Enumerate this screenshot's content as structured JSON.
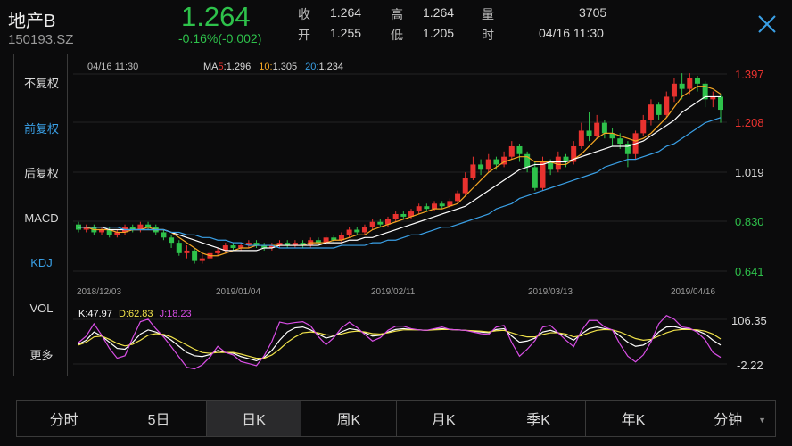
{
  "header": {
    "name": "地产B",
    "code": "150193.SZ",
    "price": "1.264",
    "change": "-0.16%(-0.002)",
    "stats": [
      {
        "label": "收",
        "value": "1.264"
      },
      {
        "label": "高",
        "value": "1.264"
      },
      {
        "label": "量",
        "value": "3705"
      },
      {
        "label": "开",
        "value": "1.255"
      },
      {
        "label": "低",
        "value": "1.205"
      },
      {
        "label": "时",
        "value": "04/16 11:30"
      }
    ]
  },
  "menu": {
    "items": [
      "不复权",
      "前复权",
      "后复权",
      "MACD",
      "KDJ",
      "VOL",
      "更多"
    ],
    "active": [
      "前复权",
      "KDJ"
    ]
  },
  "main_chart": {
    "timestamp": "04/16 11:30",
    "ma5_label": "MA5:",
    "ma5_value": "1.296",
    "ma10_label": "10:",
    "ma10_value": "1.305",
    "ma20_label": "20:",
    "ma20_value": "1.234",
    "y_ticks": [
      "1.397",
      "1.208",
      "1.019",
      "0.830",
      "0.641"
    ],
    "x_labels": [
      "2018/12/03",
      "2019/01/04",
      "2019/02/11",
      "2019/03/13",
      "2019/04/16"
    ]
  },
  "kdj_chart": {
    "k_label": "K:47.97",
    "d_label": "D:62.83",
    "j_label": "J:18.23",
    "y_ticks": [
      "106.35",
      "-2.22"
    ]
  },
  "tabs": {
    "items": [
      "分时",
      "5日",
      "日K",
      "周K",
      "月K",
      "季K",
      "年K",
      "分钟"
    ],
    "active": "日K"
  },
  "colors": {
    "up": "#e8322f",
    "down": "#2ec24b",
    "ma5": "#ffffff",
    "ma10": "#f5a623",
    "ma20": "#3aa0e6",
    "k": "#ffffff",
    "d": "#f0e24a",
    "j": "#d94ee6"
  },
  "chart_data": [
    {
      "type": "candlestick",
      "y_axis": [
        "1.397",
        "1.208",
        "1.019",
        "0.830",
        "0.641"
      ],
      "x_labels": [
        "2018/12/03",
        "2019/01/04",
        "2019/02/11",
        "2019/03/13",
        "2019/04/16"
      ],
      "candles": [
        {
          "open": 0.82,
          "close": 0.8,
          "high": 0.83,
          "low": 0.79
        },
        {
          "open": 0.8,
          "close": 0.81,
          "high": 0.82,
          "low": 0.79
        },
        {
          "open": 0.81,
          "close": 0.79,
          "high": 0.82,
          "low": 0.78
        },
        {
          "open": 0.79,
          "close": 0.8,
          "high": 0.81,
          "low": 0.78
        },
        {
          "open": 0.8,
          "close": 0.78,
          "high": 0.81,
          "low": 0.77
        },
        {
          "open": 0.78,
          "close": 0.79,
          "high": 0.8,
          "low": 0.77
        },
        {
          "open": 0.79,
          "close": 0.81,
          "high": 0.82,
          "low": 0.78
        },
        {
          "open": 0.81,
          "close": 0.8,
          "high": 0.82,
          "low": 0.79
        },
        {
          "open": 0.8,
          "close": 0.82,
          "high": 0.83,
          "low": 0.79
        },
        {
          "open": 0.82,
          "close": 0.81,
          "high": 0.83,
          "low": 0.8
        },
        {
          "open": 0.81,
          "close": 0.79,
          "high": 0.82,
          "low": 0.78
        },
        {
          "open": 0.79,
          "close": 0.77,
          "high": 0.8,
          "low": 0.76
        },
        {
          "open": 0.77,
          "close": 0.75,
          "high": 0.78,
          "low": 0.73
        },
        {
          "open": 0.75,
          "close": 0.71,
          "high": 0.76,
          "low": 0.7
        },
        {
          "open": 0.71,
          "close": 0.72,
          "high": 0.74,
          "low": 0.69
        },
        {
          "open": 0.72,
          "close": 0.68,
          "high": 0.73,
          "low": 0.67
        },
        {
          "open": 0.68,
          "close": 0.69,
          "high": 0.71,
          "low": 0.67
        },
        {
          "open": 0.69,
          "close": 0.71,
          "high": 0.72,
          "low": 0.68
        },
        {
          "open": 0.71,
          "close": 0.72,
          "high": 0.73,
          "low": 0.7
        },
        {
          "open": 0.72,
          "close": 0.74,
          "high": 0.75,
          "low": 0.71
        },
        {
          "open": 0.74,
          "close": 0.73,
          "high": 0.75,
          "low": 0.72
        },
        {
          "open": 0.73,
          "close": 0.74,
          "high": 0.75,
          "low": 0.72
        },
        {
          "open": 0.74,
          "close": 0.75,
          "high": 0.76,
          "low": 0.73
        },
        {
          "open": 0.75,
          "close": 0.74,
          "high": 0.76,
          "low": 0.73
        },
        {
          "open": 0.74,
          "close": 0.73,
          "high": 0.75,
          "low": 0.72
        },
        {
          "open": 0.73,
          "close": 0.74,
          "high": 0.75,
          "low": 0.72
        },
        {
          "open": 0.74,
          "close": 0.75,
          "high": 0.76,
          "low": 0.73
        },
        {
          "open": 0.75,
          "close": 0.74,
          "high": 0.76,
          "low": 0.73
        },
        {
          "open": 0.74,
          "close": 0.75,
          "high": 0.76,
          "low": 0.73
        },
        {
          "open": 0.75,
          "close": 0.74,
          "high": 0.76,
          "low": 0.73
        },
        {
          "open": 0.74,
          "close": 0.76,
          "high": 0.77,
          "low": 0.73
        },
        {
          "open": 0.76,
          "close": 0.75,
          "high": 0.77,
          "low": 0.74
        },
        {
          "open": 0.75,
          "close": 0.77,
          "high": 0.78,
          "low": 0.74
        },
        {
          "open": 0.77,
          "close": 0.76,
          "high": 0.78,
          "low": 0.75
        },
        {
          "open": 0.76,
          "close": 0.78,
          "high": 0.79,
          "low": 0.75
        },
        {
          "open": 0.78,
          "close": 0.8,
          "high": 0.81,
          "low": 0.77
        },
        {
          "open": 0.8,
          "close": 0.79,
          "high": 0.81,
          "low": 0.78
        },
        {
          "open": 0.79,
          "close": 0.81,
          "high": 0.82,
          "low": 0.78
        },
        {
          "open": 0.81,
          "close": 0.83,
          "high": 0.84,
          "low": 0.8
        },
        {
          "open": 0.83,
          "close": 0.82,
          "high": 0.84,
          "low": 0.81
        },
        {
          "open": 0.82,
          "close": 0.84,
          "high": 0.85,
          "low": 0.81
        },
        {
          "open": 0.84,
          "close": 0.86,
          "high": 0.87,
          "low": 0.83
        },
        {
          "open": 0.86,
          "close": 0.85,
          "high": 0.87,
          "low": 0.84
        },
        {
          "open": 0.85,
          "close": 0.87,
          "high": 0.88,
          "low": 0.84
        },
        {
          "open": 0.87,
          "close": 0.89,
          "high": 0.9,
          "low": 0.86
        },
        {
          "open": 0.89,
          "close": 0.88,
          "high": 0.9,
          "low": 0.87
        },
        {
          "open": 0.88,
          "close": 0.9,
          "high": 0.91,
          "low": 0.87
        },
        {
          "open": 0.9,
          "close": 0.89,
          "high": 0.91,
          "low": 0.88
        },
        {
          "open": 0.89,
          "close": 0.91,
          "high": 0.92,
          "low": 0.88
        },
        {
          "open": 0.91,
          "close": 0.94,
          "high": 0.95,
          "low": 0.9
        },
        {
          "open": 0.94,
          "close": 1.0,
          "high": 1.02,
          "low": 0.93
        },
        {
          "open": 1.0,
          "close": 1.05,
          "high": 1.08,
          "low": 0.99
        },
        {
          "open": 1.05,
          "close": 1.03,
          "high": 1.07,
          "low": 1.01
        },
        {
          "open": 1.03,
          "close": 1.07,
          "high": 1.09,
          "low": 1.02
        },
        {
          "open": 1.07,
          "close": 1.05,
          "high": 1.08,
          "low": 1.03
        },
        {
          "open": 1.05,
          "close": 1.08,
          "high": 1.1,
          "low": 1.04
        },
        {
          "open": 1.08,
          "close": 1.12,
          "high": 1.14,
          "low": 1.07
        },
        {
          "open": 1.12,
          "close": 1.09,
          "high": 1.13,
          "low": 1.06
        },
        {
          "open": 1.09,
          "close": 1.04,
          "high": 1.1,
          "low": 1.02
        },
        {
          "open": 1.04,
          "close": 0.96,
          "high": 1.06,
          "low": 0.95
        },
        {
          "open": 0.96,
          "close": 1.06,
          "high": 1.08,
          "low": 0.95
        },
        {
          "open": 1.06,
          "close": 1.03,
          "high": 1.07,
          "low": 1.01
        },
        {
          "open": 1.03,
          "close": 1.08,
          "high": 1.1,
          "low": 1.02
        },
        {
          "open": 1.08,
          "close": 1.06,
          "high": 1.09,
          "low": 1.04
        },
        {
          "open": 1.06,
          "close": 1.12,
          "high": 1.14,
          "low": 1.05
        },
        {
          "open": 1.12,
          "close": 1.18,
          "high": 1.21,
          "low": 1.11
        },
        {
          "open": 1.18,
          "close": 1.16,
          "high": 1.25,
          "low": 1.14
        },
        {
          "open": 1.16,
          "close": 1.21,
          "high": 1.24,
          "low": 1.15
        },
        {
          "open": 1.21,
          "close": 1.17,
          "high": 1.22,
          "low": 1.15
        },
        {
          "open": 1.17,
          "close": 1.15,
          "high": 1.19,
          "low": 1.12
        },
        {
          "open": 1.15,
          "close": 1.13,
          "high": 1.17,
          "low": 1.11
        },
        {
          "open": 1.13,
          "close": 1.09,
          "high": 1.14,
          "low": 1.04
        },
        {
          "open": 1.09,
          "close": 1.17,
          "high": 1.18,
          "low": 1.07
        },
        {
          "open": 1.17,
          "close": 1.22,
          "high": 1.24,
          "low": 1.16
        },
        {
          "open": 1.22,
          "close": 1.28,
          "high": 1.3,
          "low": 1.2
        },
        {
          "open": 1.28,
          "close": 1.24,
          "high": 1.29,
          "low": 1.22
        },
        {
          "open": 1.24,
          "close": 1.31,
          "high": 1.33,
          "low": 1.23
        },
        {
          "open": 1.31,
          "close": 1.36,
          "high": 1.38,
          "low": 1.29
        },
        {
          "open": 1.36,
          "close": 1.34,
          "high": 1.4,
          "low": 1.3
        },
        {
          "open": 1.34,
          "close": 1.38,
          "high": 1.4,
          "low": 1.32
        },
        {
          "open": 1.38,
          "close": 1.36,
          "high": 1.39,
          "low": 1.33
        },
        {
          "open": 1.36,
          "close": 1.3,
          "high": 1.37,
          "low": 1.27
        },
        {
          "open": 1.3,
          "close": 1.31,
          "high": 1.33,
          "low": 1.27
        },
        {
          "open": 1.31,
          "close": 1.26,
          "high": 1.32,
          "low": 1.21
        }
      ],
      "ma5": [
        0.81,
        0.81,
        0.8,
        0.8,
        0.8,
        0.79,
        0.79,
        0.8,
        0.8,
        0.81,
        0.8,
        0.8,
        0.79,
        0.77,
        0.75,
        0.73,
        0.71,
        0.7,
        0.7,
        0.71,
        0.72,
        0.73,
        0.73,
        0.74,
        0.74,
        0.74,
        0.74,
        0.74,
        0.74,
        0.74,
        0.75,
        0.75,
        0.75,
        0.76,
        0.76,
        0.77,
        0.78,
        0.78,
        0.8,
        0.81,
        0.82,
        0.83,
        0.84,
        0.85,
        0.86,
        0.87,
        0.88,
        0.88,
        0.89,
        0.9,
        0.93,
        0.96,
        0.99,
        1.02,
        1.04,
        1.06,
        1.07,
        1.08,
        1.08,
        1.06,
        1.06,
        1.06,
        1.05,
        1.05,
        1.07,
        1.09,
        1.12,
        1.15,
        1.17,
        1.17,
        1.16,
        1.15,
        1.14,
        1.15,
        1.17,
        1.2,
        1.23,
        1.27,
        1.31,
        1.33,
        1.35,
        1.35,
        1.34,
        1.32
      ],
      "ma10": [
        0.81,
        0.81,
        0.81,
        0.81,
        0.8,
        0.8,
        0.8,
        0.8,
        0.8,
        0.8,
        0.8,
        0.8,
        0.79,
        0.78,
        0.77,
        0.76,
        0.75,
        0.74,
        0.73,
        0.72,
        0.72,
        0.72,
        0.72,
        0.72,
        0.73,
        0.73,
        0.74,
        0.74,
        0.74,
        0.74,
        0.74,
        0.74,
        0.75,
        0.75,
        0.75,
        0.76,
        0.76,
        0.77,
        0.77,
        0.78,
        0.79,
        0.8,
        0.81,
        0.82,
        0.83,
        0.84,
        0.85,
        0.86,
        0.87,
        0.88,
        0.89,
        0.91,
        0.93,
        0.95,
        0.97,
        0.99,
        1.01,
        1.03,
        1.04,
        1.05,
        1.05,
        1.06,
        1.06,
        1.06,
        1.07,
        1.08,
        1.09,
        1.1,
        1.11,
        1.12,
        1.12,
        1.12,
        1.13,
        1.14,
        1.16,
        1.18,
        1.2,
        1.22,
        1.25,
        1.27,
        1.29,
        1.31,
        1.31,
        1.31
      ],
      "ma20": [
        0.81,
        0.81,
        0.81,
        0.81,
        0.81,
        0.81,
        0.8,
        0.8,
        0.8,
        0.8,
        0.8,
        0.8,
        0.79,
        0.79,
        0.78,
        0.78,
        0.77,
        0.77,
        0.76,
        0.76,
        0.75,
        0.75,
        0.74,
        0.74,
        0.74,
        0.74,
        0.73,
        0.73,
        0.73,
        0.73,
        0.73,
        0.73,
        0.73,
        0.73,
        0.74,
        0.74,
        0.74,
        0.74,
        0.75,
        0.75,
        0.76,
        0.76,
        0.77,
        0.78,
        0.78,
        0.79,
        0.8,
        0.81,
        0.81,
        0.82,
        0.83,
        0.84,
        0.85,
        0.86,
        0.88,
        0.89,
        0.9,
        0.92,
        0.93,
        0.94,
        0.95,
        0.96,
        0.97,
        0.98,
        0.99,
        1.0,
        1.01,
        1.02,
        1.04,
        1.05,
        1.06,
        1.07,
        1.07,
        1.08,
        1.09,
        1.1,
        1.12,
        1.13,
        1.15,
        1.17,
        1.19,
        1.21,
        1.22,
        1.23
      ]
    },
    {
      "type": "line",
      "title": "KDJ",
      "y_axis": [
        "106.35",
        "-2.22"
      ],
      "series": [
        {
          "name": "K",
          "values": [
            50,
            60,
            80,
            70,
            55,
            40,
            38,
            55,
            75,
            85,
            80,
            72,
            60,
            45,
            30,
            22,
            20,
            25,
            35,
            30,
            28,
            20,
            15,
            10,
            18,
            35,
            60,
            80,
            90,
            92,
            85,
            75,
            65,
            70,
            80,
            88,
            85,
            78,
            70,
            72,
            80,
            86,
            88,
            86,
            85,
            84,
            86,
            88,
            86,
            85,
            84,
            82,
            80,
            78,
            86,
            88,
            70,
            55,
            58,
            65,
            80,
            84,
            78,
            70,
            60,
            75,
            88,
            92,
            88,
            85,
            70,
            55,
            45,
            48,
            60,
            80,
            92,
            93,
            88,
            87,
            83,
            75,
            60,
            48
          ]
        },
        {
          "name": "D",
          "values": [
            48,
            55,
            68,
            70,
            62,
            52,
            46,
            50,
            60,
            72,
            76,
            74,
            68,
            58,
            48,
            38,
            30,
            28,
            30,
            30,
            30,
            26,
            21,
            16,
            16,
            24,
            38,
            55,
            68,
            78,
            80,
            78,
            73,
            72,
            75,
            80,
            82,
            80,
            76,
            75,
            78,
            82,
            85,
            85,
            85,
            84,
            85,
            86,
            86,
            85,
            84,
            83,
            82,
            80,
            83,
            84,
            78,
            72,
            68,
            68,
            74,
            78,
            78,
            75,
            68,
            71,
            78,
            84,
            86,
            85,
            80,
            72,
            64,
            60,
            62,
            70,
            78,
            84,
            86,
            86,
            85,
            82,
            75,
            63
          ]
        },
        {
          "name": "J",
          "values": [
            54,
            70,
            100,
            72,
            40,
            16,
            22,
            65,
            105,
            111,
            88,
            68,
            44,
            19,
            -6,
            -10,
            0,
            19,
            45,
            30,
            24,
            8,
            3,
            -2,
            22,
            57,
            104,
            100,
            103,
            105,
            95,
            69,
            49,
            66,
            90,
            104,
            91,
            74,
            58,
            66,
            84,
            94,
            94,
            88,
            85,
            84,
            88,
            92,
            86,
            85,
            84,
            80,
            76,
            74,
            92,
            96,
            54,
            21,
            38,
            59,
            92,
            96,
            78,
            60,
            44,
            83,
            108,
            108,
            92,
            85,
            50,
            21,
            7,
            24,
            56,
            100,
            120,
            111,
            92,
            89,
            79,
            61,
            30,
            18
          ]
        }
      ]
    }
  ]
}
